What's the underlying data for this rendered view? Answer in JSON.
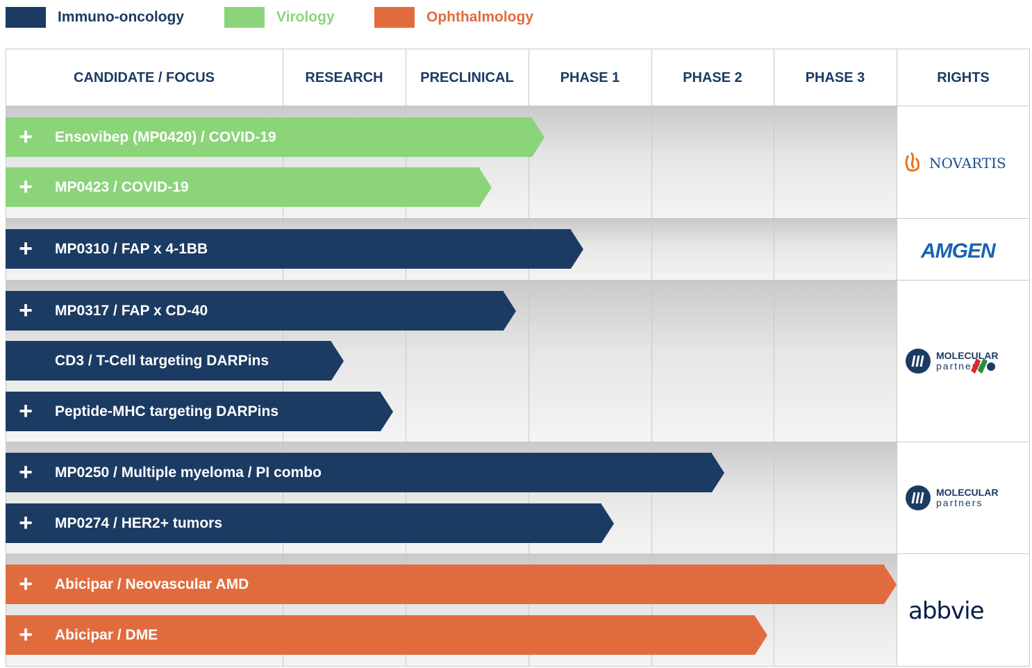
{
  "legend": [
    {
      "label": "Immuno-oncology",
      "color": "#1b3b63",
      "text_color": "#1b3b63"
    },
    {
      "label": "Virology",
      "color": "#8bd47a",
      "text_color": "#8bd47a"
    },
    {
      "label": "Ophthalmology",
      "color": "#e06c3e",
      "text_color": "#e06c3e"
    }
  ],
  "header": {
    "candidate": "CANDIDATE / FOCUS",
    "research": "RESEARCH",
    "preclinical": "PRECLINICAL",
    "phase1": "PHASE 1",
    "phase2": "PHASE 2",
    "phase3": "PHASE 3",
    "rights": "RIGHTS"
  },
  "rights": {
    "novartis": "NOVARTIS",
    "amgen": "AMGEN",
    "molecular_top": "MOLECULAR",
    "molecular_bottom": "partners",
    "abbvie": "abbvie"
  },
  "chart_data": {
    "type": "bar",
    "orientation": "horizontal",
    "stages": [
      "RESEARCH",
      "PRECLINICAL",
      "PHASE 1",
      "PHASE 2",
      "PHASE 3"
    ],
    "scale_note": "progress in stage columns (1.0 = end of RESEARCH, 5.0 = end of PHASE 3)",
    "xlim": [
      0,
      5
    ],
    "series": [
      {
        "name": "Virology",
        "color": "#8bd47a"
      },
      {
        "name": "Immuno-oncology",
        "color": "#1b3b63"
      },
      {
        "name": "Ophthalmology",
        "color": "#e06c3e"
      }
    ],
    "candidates": [
      {
        "label": "Ensovibep (MP0420) / COVID-19",
        "area": "Virology",
        "progress": 2.13,
        "plus": true,
        "rights": "NOVARTIS"
      },
      {
        "label": "MP0423 / COVID-19",
        "area": "Virology",
        "progress": 1.7,
        "plus": true,
        "rights": "NOVARTIS"
      },
      {
        "label": "MP0310 / FAP x 4-1BB",
        "area": "Immuno-oncology",
        "progress": 2.45,
        "plus": true,
        "rights": "AMGEN"
      },
      {
        "label": "MP0317 / FAP x CD-40",
        "area": "Immuno-oncology",
        "progress": 1.9,
        "plus": true,
        "rights": "MOLECULAR partners"
      },
      {
        "label": "CD3 / T-Cell targeting DARPins",
        "area": "Immuno-oncology",
        "progress": 0.5,
        "plus": false,
        "rights": "MOLECULAR partners"
      },
      {
        "label": "Peptide-MHC targeting DARPins",
        "area": "Immuno-oncology",
        "progress": 0.9,
        "plus": true,
        "rights": "MOLECULAR partners"
      },
      {
        "label": "MP0250 / Multiple myeloma / PI combo",
        "area": "Immuno-oncology",
        "progress": 3.6,
        "plus": true,
        "rights": "MOLECULAR partners"
      },
      {
        "label": "MP0274 / HER2+ tumors",
        "area": "Immuno-oncology",
        "progress": 2.7,
        "plus": true,
        "rights": "MOLECULAR partners"
      },
      {
        "label": "Abicipar / Neovascular AMD",
        "area": "Ophthalmology",
        "progress": 5.0,
        "plus": true,
        "rights": "abbvie"
      },
      {
        "label": "Abicipar / DME",
        "area": "Ophthalmology",
        "progress": 3.95,
        "plus": true,
        "rights": "abbvie"
      }
    ]
  }
}
